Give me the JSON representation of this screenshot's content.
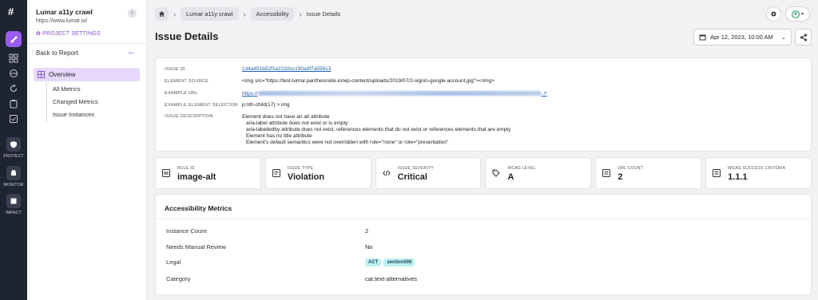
{
  "app": {
    "logo_glyph": "#",
    "rail_sections": [
      {
        "label": "PROTECT",
        "icon": "shield-icon"
      },
      {
        "label": "MONITOR",
        "icon": "monitor-icon"
      },
      {
        "label": "IMPACT",
        "icon": "impact-icon"
      }
    ],
    "accent": "#9b5cf0"
  },
  "sidebar": {
    "project_name": "Lumar a11y crawl",
    "project_url": "https://www.lumar.io/",
    "settings_label": "PROJECT SETTINGS",
    "back_label": "Back to Report",
    "overview_label": "Overview",
    "sub_items": [
      "All Metrics",
      "Changed Metrics",
      "Issue Instances"
    ]
  },
  "header": {
    "breadcrumbs": [
      "Lumar a11y crawl",
      "Accessibility",
      "Issue Details"
    ],
    "title": "Issue Details",
    "date": "Apr 12, 2023, 10:00 AM"
  },
  "details": {
    "issue_id_label": "ISSUE ID",
    "issue_id": "134a451b52f1e222dcc190a0f7a55613",
    "element_source_label": "ELEMENT SOURCE",
    "element_source": "<img src=\"https://test-lumar.pantheonsite.io/wp-content/uploads/2019/07/2-signin-google-account.jpg\"></img>",
    "example_url_label": "EXAMPLE URL",
    "example_url_prefix": "https://",
    "selector_label": "EXAMPLE ELEMENT SELECTOR",
    "selector": "p:nth-child(17) > img",
    "description_label": "ISSUE DESCRIPTION",
    "description_lines": [
      "Element does not have an alt attribute",
      "aria-label attribute does not exist or is empty",
      "aria-labelledby attribute does not exist, references elements that do not exist or references elements that are empty",
      "Element has no title attribute",
      "Element's default semantics were not overridden with role=\"none\" or role=\"presentation\""
    ]
  },
  "metric_cards": [
    {
      "label": "RULE ID",
      "value": "image-alt",
      "icon": "barcode-icon"
    },
    {
      "label": "ISSUE TYPE",
      "value": "Violation",
      "icon": "document-icon"
    },
    {
      "label": "ISSUE SEVERITY",
      "value": "Critical",
      "icon": "code-icon"
    },
    {
      "label": "WCAG LEVEL",
      "value": "A",
      "icon": "tag-icon"
    },
    {
      "label": "URL COUNT",
      "value": "2",
      "icon": "list-icon"
    },
    {
      "label": "WCAG SUCCESS CRITERIA",
      "value": "1.1.1",
      "icon": "list-icon"
    }
  ],
  "accessibility_metrics": {
    "title": "Accessibility Metrics",
    "rows": [
      {
        "key": "Instance Count",
        "value": "2"
      },
      {
        "key": "Needs Manual Review",
        "value": "No"
      },
      {
        "key": "Legal",
        "tags": [
          "ACT",
          "section508"
        ]
      },
      {
        "key": "Category",
        "value": "cat.text-alternatives"
      }
    ],
    "tag_color": "#bdeef2"
  }
}
